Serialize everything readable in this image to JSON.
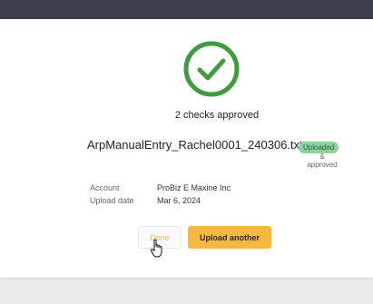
{
  "dialog": {
    "title": "2 checks approved",
    "filename": "ArpManualEntry_Rachel0001_240306.txt",
    "status_badge": "Uploaded",
    "status_amp": "&",
    "status_sub": "approved",
    "account_label": "Account",
    "account_value": "ProBiz E Maxine Inc",
    "date_label": "Upload date",
    "date_value": "Mar 6, 2024",
    "done_label": "Done",
    "upload_another_label": "Upload another"
  },
  "colors": {
    "success_green": "#3f9b3f",
    "badge_green": "#8fd19e",
    "accent_yellow": "#f5b942",
    "topbar": "#3b3f4a"
  },
  "icons": {
    "status": "check-circle-icon",
    "cursor": "hand-pointer-icon"
  }
}
